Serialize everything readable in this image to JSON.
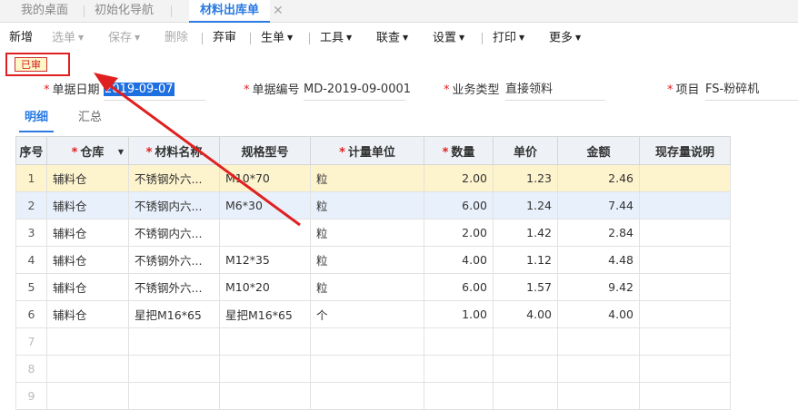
{
  "tabs": [
    {
      "label": "我的桌面",
      "active": false
    },
    {
      "label": "初始化导航",
      "active": false
    },
    {
      "label": "材料出库单",
      "active": true
    }
  ],
  "tab_close_glyph": "✕",
  "toolbar": {
    "new": "新增",
    "select": "选单",
    "save": "保存",
    "delete": "删除",
    "abandon": "弃审",
    "generate": "生单",
    "tools": "工具",
    "query": "联查",
    "settings": "设置",
    "print": "打印",
    "more": "更多",
    "caret": "▼"
  },
  "status_badge": "已审",
  "form": {
    "date_label": "单据日期",
    "date_value": "2019-09-07",
    "number_label": "单据编号",
    "number_value": "MD-2019-09-0001",
    "biz_type_label": "业务类型",
    "biz_type_value": "直接领料",
    "project_label": "项目",
    "project_value": "FS-粉碎机",
    "required_mark": "*"
  },
  "subtabs": [
    "明细",
    "汇总"
  ],
  "table": {
    "headers": [
      "序号",
      "仓库",
      "材料名称",
      "规格型号",
      "计量单位",
      "数量",
      "单价",
      "金额",
      "现存量说明"
    ],
    "rows": [
      {
        "idx": "1",
        "warehouse": "辅料仓",
        "name": "不锈钢外六...",
        "spec": "M10*70",
        "unit": "粒",
        "qty": "2.00",
        "price": "1.23",
        "amount": "2.46",
        "note": ""
      },
      {
        "idx": "2",
        "warehouse": "辅料仓",
        "name": "不锈钢内六...",
        "spec": "M6*30",
        "unit": "粒",
        "qty": "6.00",
        "price": "1.24",
        "amount": "7.44",
        "note": ""
      },
      {
        "idx": "3",
        "warehouse": "辅料仓",
        "name": "不锈钢内六...",
        "spec": "",
        "unit": "粒",
        "qty": "2.00",
        "price": "1.42",
        "amount": "2.84",
        "note": ""
      },
      {
        "idx": "4",
        "warehouse": "辅料仓",
        "name": "不锈钢外六...",
        "spec": "M12*35",
        "unit": "粒",
        "qty": "4.00",
        "price": "1.12",
        "amount": "4.48",
        "note": ""
      },
      {
        "idx": "5",
        "warehouse": "辅料仓",
        "name": "不锈钢外六...",
        "spec": "M10*20",
        "unit": "粒",
        "qty": "6.00",
        "price": "1.57",
        "amount": "9.42",
        "note": ""
      },
      {
        "idx": "6",
        "warehouse": "辅料仓",
        "name": "星把M16*65",
        "spec": "星把M16*65",
        "unit": "个",
        "qty": "1.00",
        "price": "4.00",
        "amount": "4.00",
        "note": ""
      }
    ],
    "empty_rows": [
      "7",
      "8",
      "9"
    ]
  },
  "colors": {
    "accent": "#2a7ae2",
    "annotation": "#e02020",
    "row_highlight": "#fdf3cd",
    "row_selected": "#e8f1fb"
  }
}
